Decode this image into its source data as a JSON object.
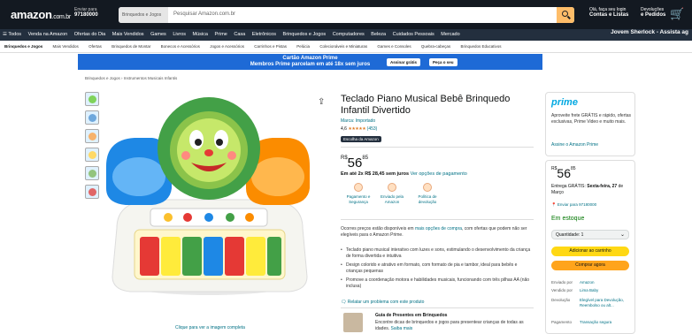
{
  "header": {
    "logo": "amazon",
    "logo_suffix": ".com.br",
    "deliver_line1": "Enviar para",
    "deliver_line2": "97180000",
    "search_category": "Brinquedos e Jogos",
    "search_placeholder": "Pesquisar Amazon.com.br",
    "account_line1": "Olá, faça seu login",
    "account_line2": "Contas e Listas",
    "returns_line1": "Devoluções",
    "returns_line2": "e Pedidos"
  },
  "nav": {
    "items": [
      "☰ Todos",
      "Venda na Amazon",
      "Ofertas do Dia",
      "Mais Vendidos",
      "Games",
      "Livros",
      "Música",
      "Prime",
      "Casa",
      "Eletrônicos",
      "Brinquedos e Jogos",
      "Computadores",
      "Beleza",
      "Cuidados Pessoais",
      "Mercado"
    ],
    "right_promo": "Jovem Sherlock - Assista ag"
  },
  "subnav": {
    "items": [
      "Brinquedos e Jogos",
      "Mais Vendidos",
      "Ofertas",
      "Brinquedos de Montar",
      "Bonecos e Acessórios",
      "Jogos e Acessórios",
      "Carrinhos e Pistas",
      "Pelúcia",
      "Colecionáveis e Miniaturas",
      "Games e Consoles",
      "Quebra-cabeças",
      "Brinquedos Educativos"
    ]
  },
  "banner": {
    "line1": "Cartão Amazon Prime",
    "line2": "Membros Prime parcelam em até 18x sem juros",
    "btn1": "Assinar grátis",
    "btn2": "Peça o seu"
  },
  "breadcrumb": "Brinquedos e Jogos › Instrumentos Musicais Infantis",
  "product": {
    "title": "Teclado Piano Musical Bebê Brinquedo Infantil Divertido",
    "store": "Marca: Importado",
    "rating": "4,6",
    "stars": "★★★★★",
    "rating_count": "(453)",
    "badge": "Escolha da Amazon",
    "price_currency": "R$",
    "price_int": "56",
    "price_cents": "85",
    "installments_bold": "Em até 2x R$ 28,45 sem juros",
    "installments_link": "Ver opções de pagamento",
    "image_caption": "Clique para ver a imagem completa"
  },
  "features": [
    {
      "label": "Pagamento e Segurança"
    },
    {
      "label": "Enviado pela Amazon"
    },
    {
      "label": "Política de devolução"
    }
  ],
  "description": {
    "text_prefix": "Ocorres preços estão disponíveis em",
    "link": "mais opções de compra",
    "text_suffix": ", com ofertas que podem não ser elegíveis para o Amazon Prime.",
    "bullets": [
      "Teclado piano musical interativo com luzes e sons, estimulando o desenvolvimento da criança de forma divertida e intuitiva",
      "Design colorido e atrativo em formato, com formato de pia e tambor, ideal para bebês e crianças pequenas",
      "Promove a coordenação motora e habilidades musicais, funcionando com três pilhas AA (não inclusa)"
    ],
    "report": "Relatar um problema com este produto"
  },
  "guide": {
    "title": "Guia de Presentes em Brinquedos",
    "text": "Encontre dicas de brinquedos e jogos para presentear crianças de todas as idades.",
    "link": "Saiba mais"
  },
  "prime_box": {
    "logo": "prime",
    "text": "Aproveite frete GRÁTIS e rápido, ofertas exclusivas, Prime Video e muito mais.",
    "link": "Assine o Amazon Prime"
  },
  "buy_box": {
    "price_currency": "R$",
    "price_int": "56",
    "price_cents": "85",
    "ship_prefix": "Entrega GRÁTIS:",
    "ship_bold": "Sexta-feira, 27",
    "ship_suffix": "de Março",
    "location": "Enviar para 97180000",
    "stock": "Em estoque",
    "quantity": "Quantidade: 1",
    "add_to_cart": "Adicionar ao carrinho",
    "buy_now": "Comprar agora",
    "details": [
      {
        "k": "Enviado por",
        "v": "Amazon"
      },
      {
        "k": "Vendido por",
        "v": "Lima Baby"
      },
      {
        "k": "Devolução",
        "v": "Elegível para Devolução, Reembolso ou alt..."
      },
      {
        "k": "Pagamento",
        "v": "Transação segura"
      }
    ]
  },
  "colors": {
    "header_bg": "#131921",
    "nav_bg": "#232f3e",
    "banner_bg": "#1e6ad6",
    "link": "#007185",
    "cart_button": "#ffd814",
    "buy_button": "#ffa41c",
    "in_stock": "#007600",
    "prime": "#00a8e1"
  }
}
